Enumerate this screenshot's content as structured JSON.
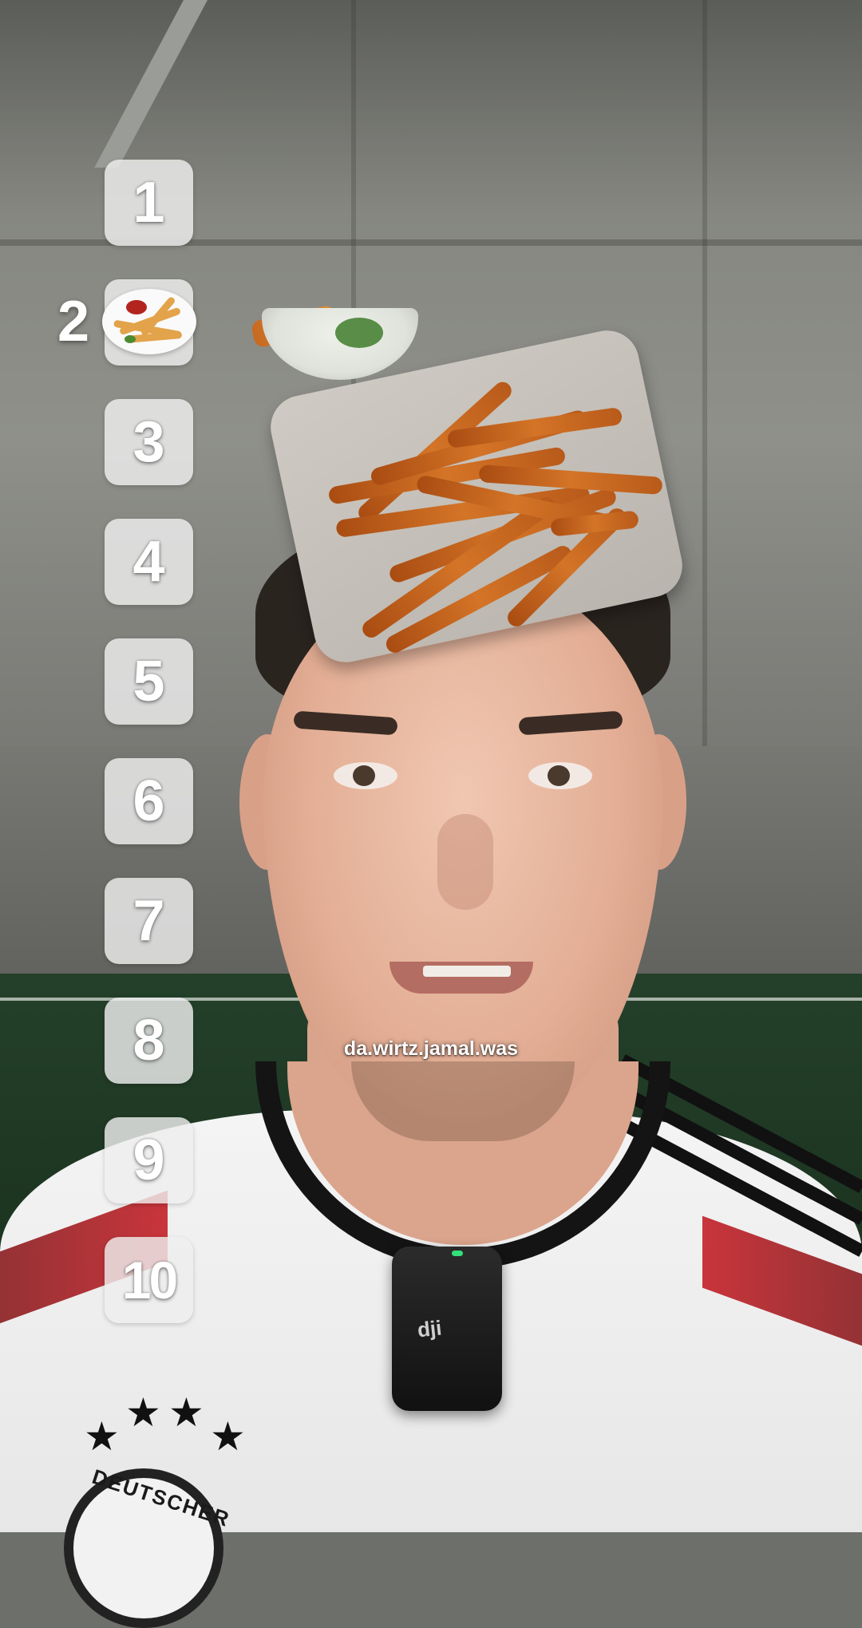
{
  "ranking": {
    "slots": [
      {
        "number": "1"
      },
      {
        "number": "2",
        "filled": true,
        "item_icon": "fries-plate-icon"
      },
      {
        "number": "3"
      },
      {
        "number": "4"
      },
      {
        "number": "5"
      },
      {
        "number": "6"
      },
      {
        "number": "7"
      },
      {
        "number": "8"
      },
      {
        "number": "9"
      },
      {
        "number": "10"
      }
    ]
  },
  "current_item": {
    "icon": "sweet-potato-fries-icon"
  },
  "overlay": {
    "username": "da.wirtz.jamal.was"
  },
  "jersey": {
    "crest_text": "DEUTSCHER"
  },
  "mic": {
    "brand": "dji"
  },
  "colors": {
    "slot_bg": "#eeeeee",
    "jersey_red": "#c42027",
    "mic_led": "#35e07a"
  }
}
